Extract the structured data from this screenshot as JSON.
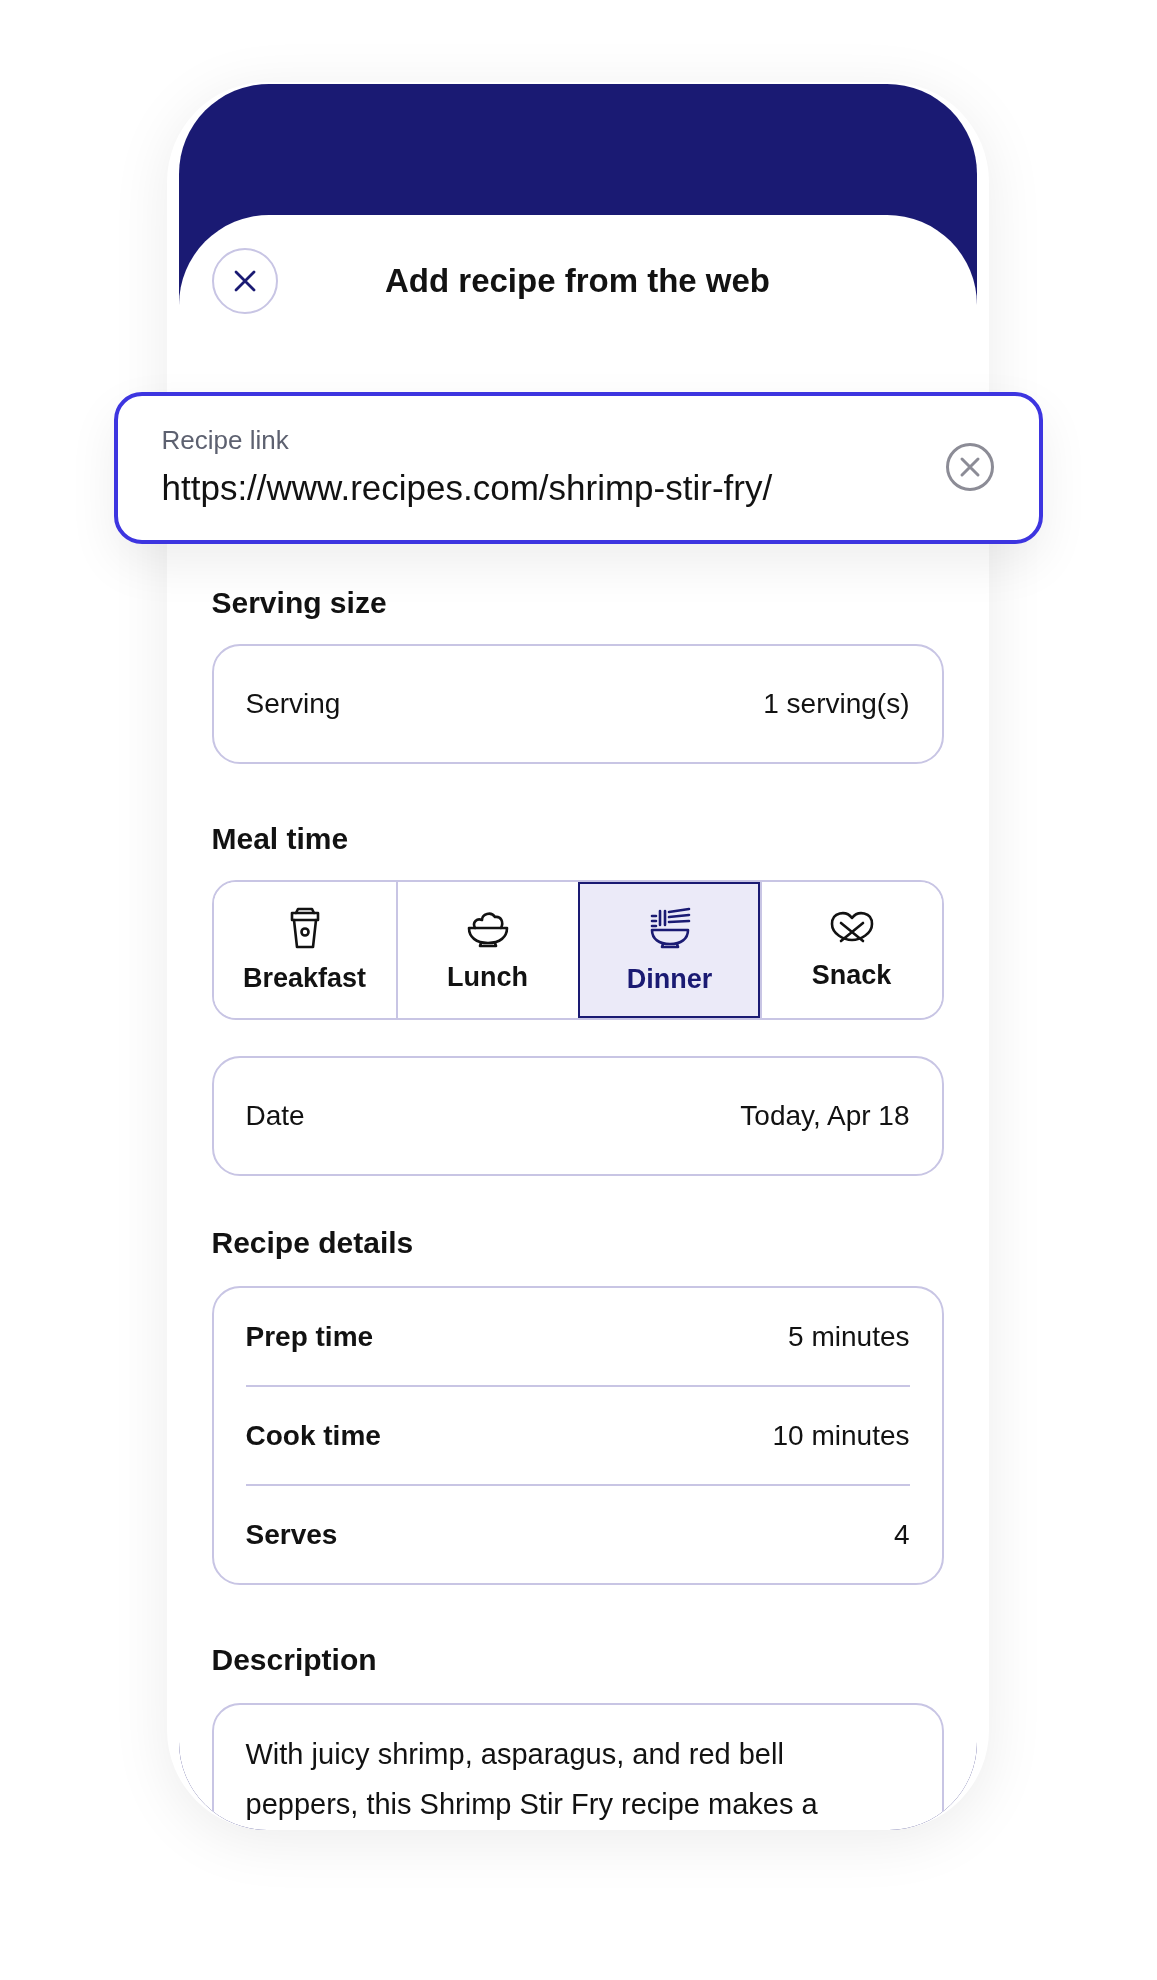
{
  "header": {
    "title": "Add recipe from the web"
  },
  "recipe_link": {
    "label": "Recipe link",
    "value": "https://www.recipes.com/shrimp-stir-fry/"
  },
  "serving_size": {
    "heading": "Serving size",
    "label": "Serving",
    "value": "1 serving(s)"
  },
  "meal_time": {
    "heading": "Meal time",
    "options": [
      {
        "label": "Breakfast",
        "kind": "cup",
        "selected": false
      },
      {
        "label": "Lunch",
        "kind": "salad",
        "selected": false
      },
      {
        "label": "Dinner",
        "kind": "noodles",
        "selected": true
      },
      {
        "label": "Snack",
        "kind": "pretzel",
        "selected": false
      }
    ]
  },
  "date": {
    "label": "Date",
    "value": "Today, Apr 18"
  },
  "recipe_details": {
    "heading": "Recipe details",
    "rows": [
      {
        "label": "Prep time",
        "value": "5 minutes"
      },
      {
        "label": "Cook time",
        "value": "10 minutes"
      },
      {
        "label": "Serves",
        "value": "4"
      }
    ]
  },
  "description": {
    "heading": "Description",
    "text": "With juicy shrimp, asparagus, and red bell peppers, this Shrimp Stir Fry recipe makes a"
  }
}
